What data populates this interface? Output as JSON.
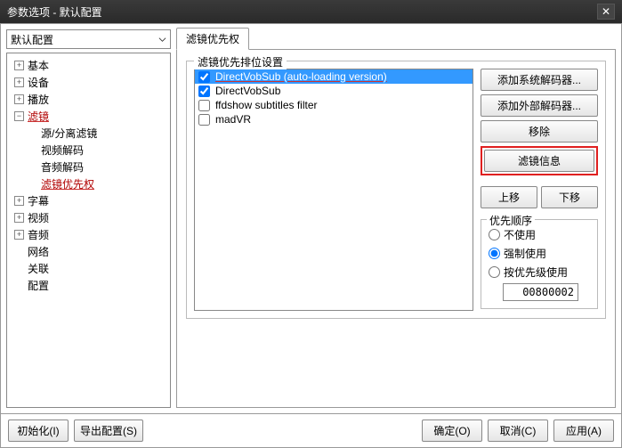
{
  "window": {
    "title": "参数选项 - 默认配置"
  },
  "profile": {
    "selected": "默认配置"
  },
  "tree": {
    "items": [
      {
        "label": "基本",
        "expand": "▸",
        "level": 1
      },
      {
        "label": "设备",
        "expand": "▸",
        "level": 1
      },
      {
        "label": "播放",
        "expand": "▸",
        "level": 1
      },
      {
        "label": "滤镜",
        "expand": "▾",
        "level": 1,
        "active": true
      },
      {
        "label": "源/分离滤镜",
        "level": 2
      },
      {
        "label": "视频解码",
        "level": 2
      },
      {
        "label": "音频解码",
        "level": 2
      },
      {
        "label": "滤镜优先权",
        "level": 2,
        "active": true
      },
      {
        "label": "字幕",
        "expand": "▸",
        "level": 1
      },
      {
        "label": "视频",
        "expand": "▸",
        "level": 1
      },
      {
        "label": "音频",
        "expand": "▸",
        "level": 1
      },
      {
        "label": "网络",
        "level": 1,
        "leaf": true
      },
      {
        "label": "关联",
        "level": 1,
        "leaf": true
      },
      {
        "label": "配置",
        "level": 1,
        "leaf": true
      }
    ]
  },
  "tab": {
    "label": "滤镜优先权"
  },
  "group": {
    "title": "滤镜优先排位设置"
  },
  "filters": [
    {
      "label": "DirectVobSub (auto-loading version)",
      "checked": true,
      "selected": true,
      "underline": true
    },
    {
      "label": "DirectVobSub",
      "checked": true
    },
    {
      "label": "ffdshow subtitles filter",
      "checked": false
    },
    {
      "label": "madVR",
      "checked": false
    }
  ],
  "buttons": {
    "add_sys": "添加系统解码器...",
    "add_ext": "添加外部解码器...",
    "remove": "移除",
    "info": "滤镜信息",
    "up": "上移",
    "down": "下移"
  },
  "priority": {
    "title": "优先顺序",
    "opt_disable": "不使用",
    "opt_force": "强制使用",
    "opt_level": "按优先级使用",
    "value": "00800002"
  },
  "footer": {
    "init": "初始化(I)",
    "export": "导出配置(S)",
    "ok": "确定(O)",
    "cancel": "取消(C)",
    "apply": "应用(A)"
  }
}
